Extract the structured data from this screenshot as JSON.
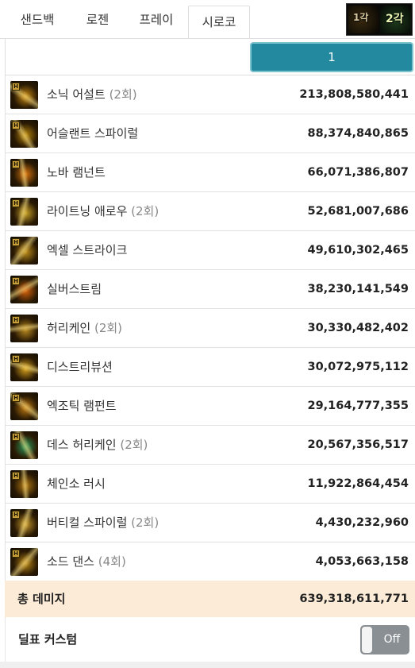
{
  "tabs": [
    {
      "label": "샌드백",
      "active": false
    },
    {
      "label": "로젠",
      "active": false
    },
    {
      "label": "프레이",
      "active": false
    },
    {
      "label": "시로코",
      "active": true
    }
  ],
  "thumbnail": {
    "left_caption": "1각",
    "right_caption": "2각"
  },
  "pagination": {
    "current_page": "1"
  },
  "skills": [
    {
      "name": "소닉 어설트",
      "hits": "(2회)",
      "damage": "213,808,580,441",
      "icon": "sonic-assault-icon",
      "color": "#c98a12"
    },
    {
      "name": "어슬랜트 스파이럴",
      "hits": "",
      "damage": "88,374,840,865",
      "icon": "aslant-spiral-icon",
      "color": "#b8860b"
    },
    {
      "name": "노바 램넌트",
      "hits": "",
      "damage": "66,071,386,807",
      "icon": "nova-remnant-icon",
      "color": "#d9740e"
    },
    {
      "name": "라이트닝 애로우",
      "hits": "(2회)",
      "damage": "52,681,007,686",
      "icon": "lightning-arrow-icon",
      "color": "#c9a227"
    },
    {
      "name": "엑셀 스트라이크",
      "hits": "",
      "damage": "49,610,302,465",
      "icon": "excel-strike-icon",
      "color": "#bf8f1a"
    },
    {
      "name": "실버스트림",
      "hits": "",
      "damage": "38,230,141,549",
      "icon": "silver-stream-icon",
      "color": "#d8620c"
    },
    {
      "name": "허리케인",
      "hits": "(2회)",
      "damage": "30,330,482,402",
      "icon": "hurricane-icon",
      "color": "#b98a20"
    },
    {
      "name": "디스트리뷰션",
      "hits": "",
      "damage": "30,072,975,112",
      "icon": "distribution-icon",
      "color": "#d8a21c"
    },
    {
      "name": "엑조틱 램펀트",
      "hits": "",
      "damage": "29,164,777,355",
      "icon": "exotic-rampant-icon",
      "color": "#c07a10"
    },
    {
      "name": "데스 허리케인",
      "hits": "(2회)",
      "damage": "20,567,356,517",
      "icon": "death-hurricane-icon",
      "color": "#2a9a5a"
    },
    {
      "name": "체인소 러시",
      "hits": "",
      "damage": "11,922,864,454",
      "icon": "chainsaw-rush-icon",
      "color": "#b07812"
    },
    {
      "name": "버티컬 스파이럴",
      "hits": "(2회)",
      "damage": "4,430,232,960",
      "icon": "vertical-spiral-icon",
      "color": "#c4962a"
    },
    {
      "name": "소드 댄스",
      "hits": "(4회)",
      "damage": "4,053,663,158",
      "icon": "sword-dance-icon",
      "color": "#b98716"
    }
  ],
  "total": {
    "label": "총 데미지",
    "value": "639,318,611,771"
  },
  "custom": {
    "label": "딜표 커스텀",
    "toggle_label": "Off",
    "toggle_on": false
  },
  "colors": {
    "accent": "#23899f",
    "total_bg": "#fcebd6",
    "toggle_off": "#8a8f93"
  }
}
